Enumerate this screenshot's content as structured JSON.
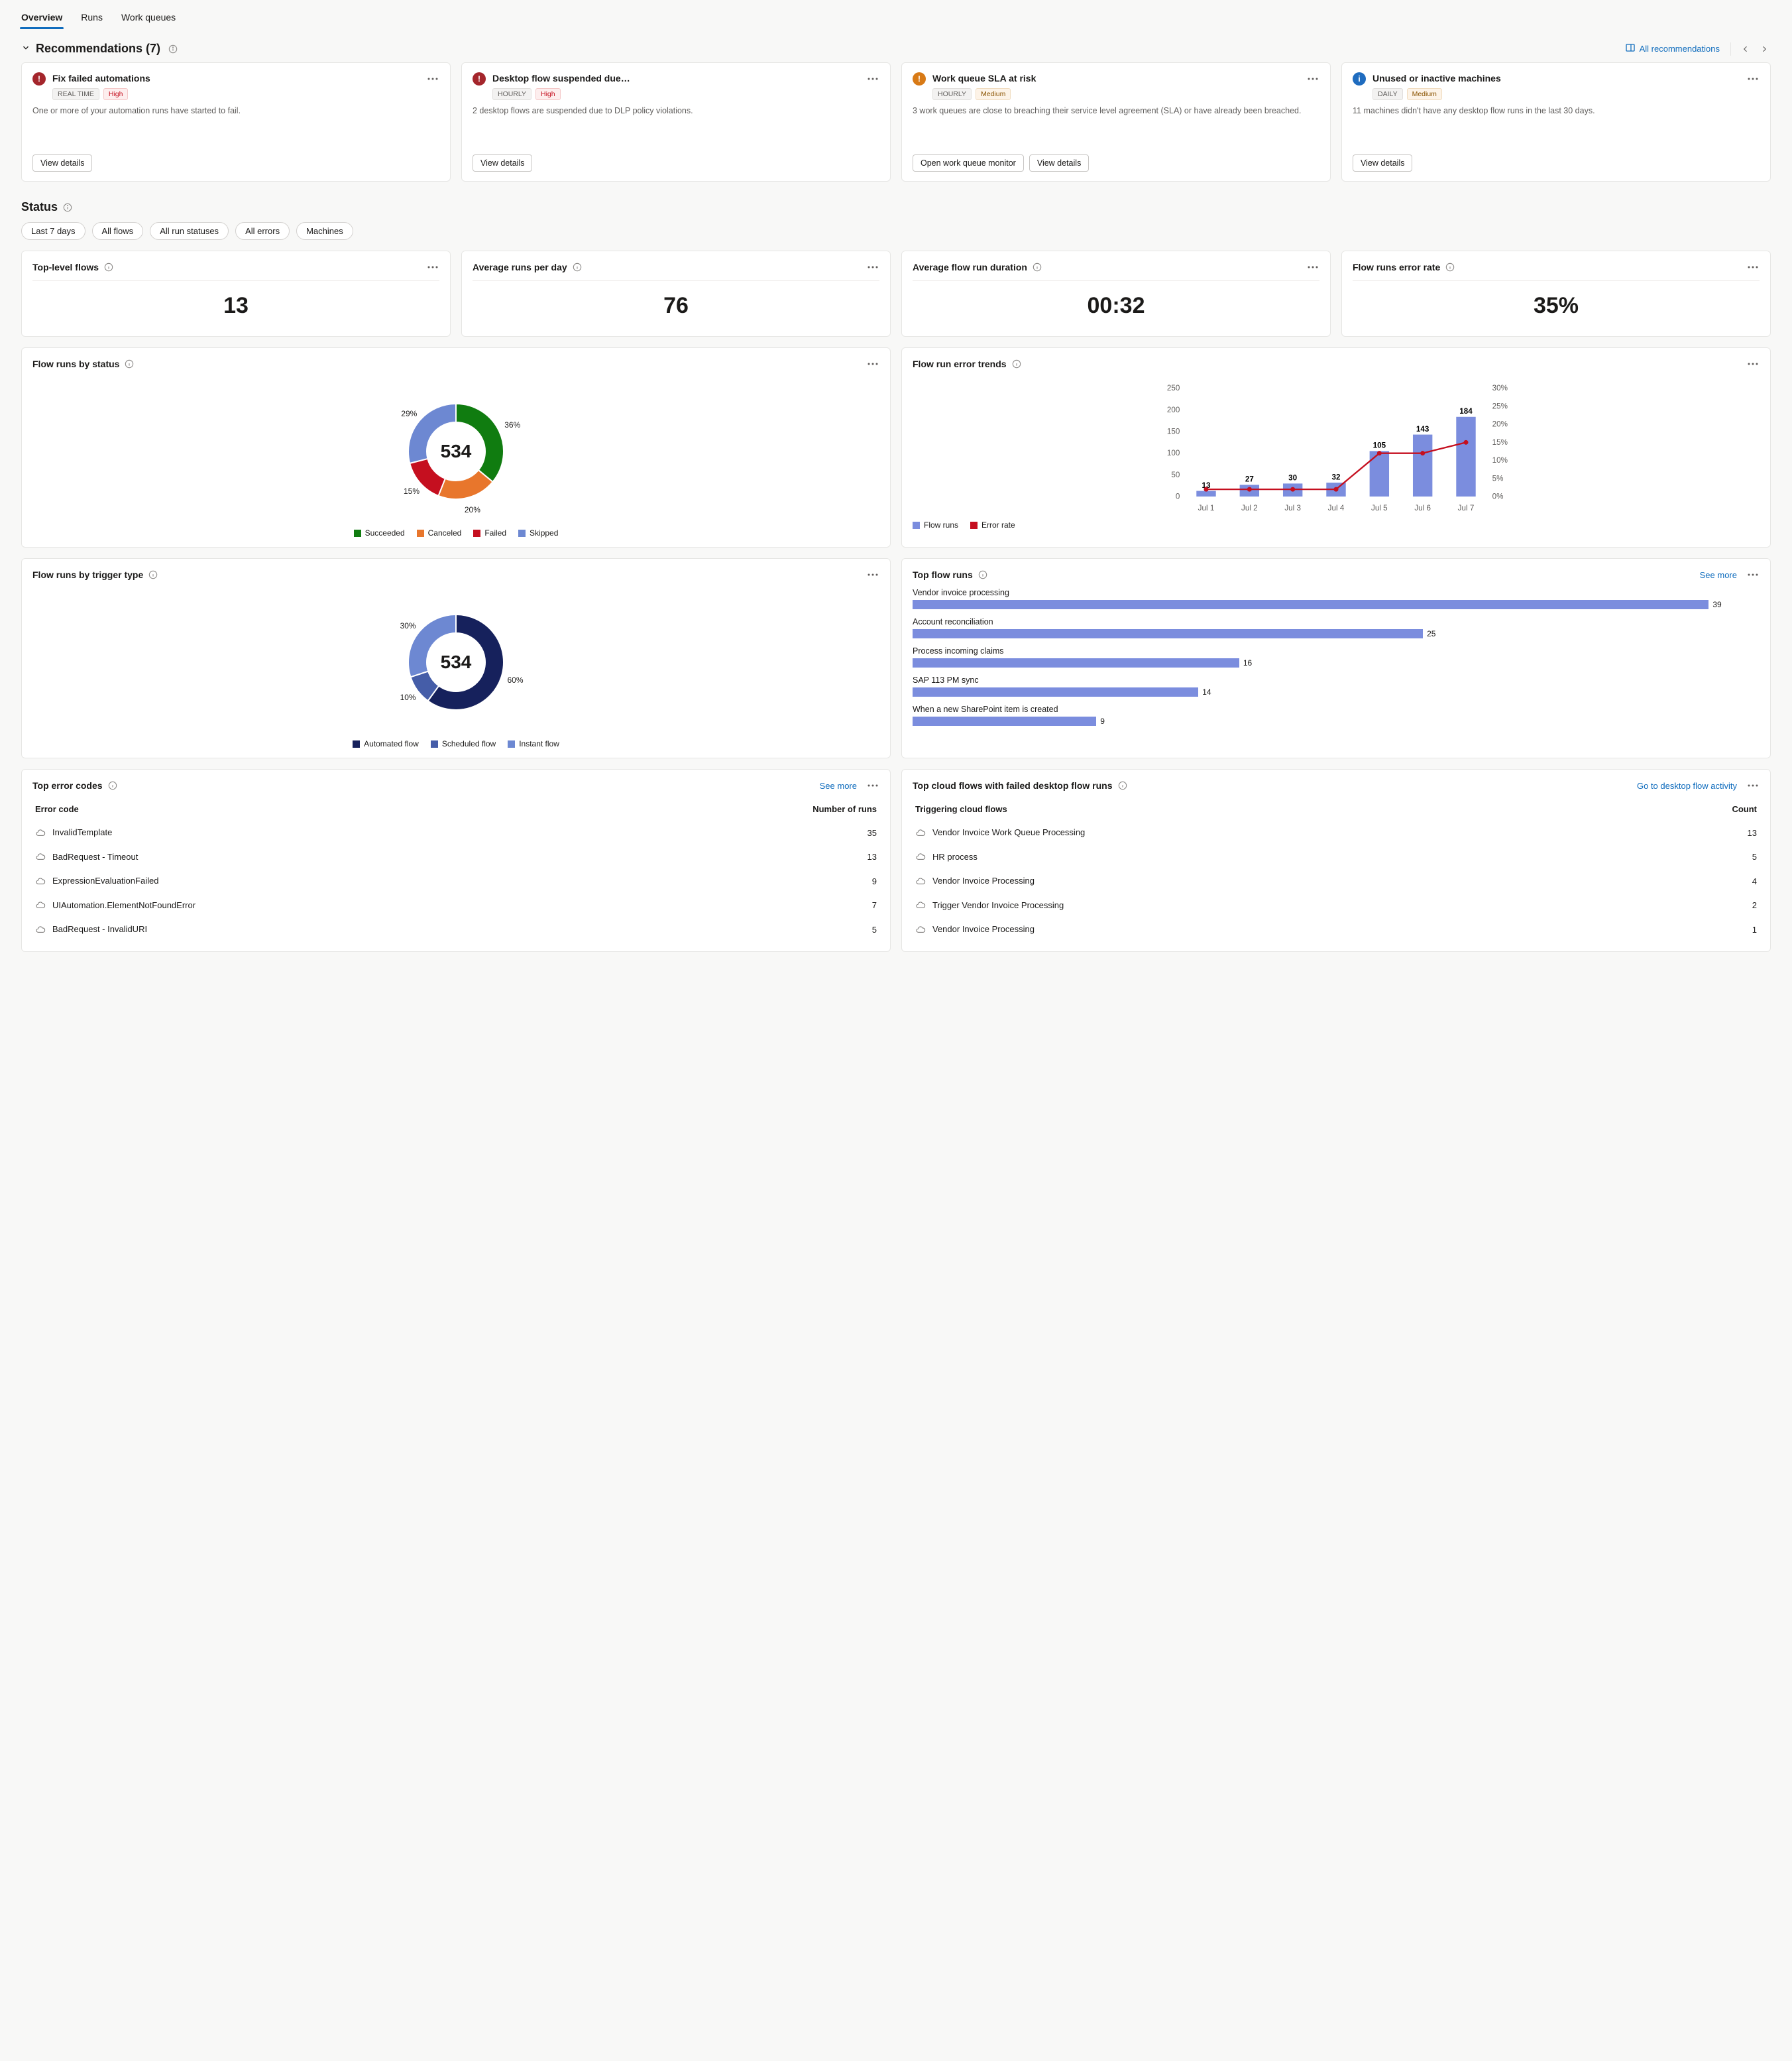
{
  "tabs": {
    "overview": "Overview",
    "runs": "Runs",
    "work_queues": "Work queues"
  },
  "recommendations": {
    "title": "Recommendations (7)",
    "all_link": "All recommendations",
    "cards": [
      {
        "title": "Fix failed automations",
        "freq": "REAL TIME",
        "sev": "High",
        "desc": "One or more of your automation runs have started to fail.",
        "btn1": "View details"
      },
      {
        "title": "Desktop flow suspended due…",
        "freq": "HOURLY",
        "sev": "High",
        "desc": "2 desktop flows are suspended due to DLP policy violations.",
        "btn1": "View details"
      },
      {
        "title": "Work queue SLA at risk",
        "freq": "HOURLY",
        "sev": "Medium",
        "desc": "3 work queues are close to breaching their service level agreement (SLA) or have already been breached.",
        "btn1": "Open work queue monitor",
        "btn2": "View details"
      },
      {
        "title": "Unused or inactive machines",
        "freq": "DAILY",
        "sev": "Medium",
        "desc": "11 machines didn't have any desktop flow runs in the last 30 days.",
        "btn1": "View details"
      }
    ]
  },
  "status": {
    "title": "Status",
    "filters": [
      "Last 7 days",
      "All flows",
      "All run statuses",
      "All errors",
      "Machines"
    ],
    "kpis": [
      {
        "title": "Top-level flows",
        "value": "13"
      },
      {
        "title": "Average runs per day",
        "value": "76"
      },
      {
        "title": "Average flow run duration",
        "value": "00:32"
      },
      {
        "title": "Flow runs error rate",
        "value": "35%"
      }
    ]
  },
  "charts": {
    "by_status": {
      "title": "Flow runs by status",
      "center": "534",
      "legend": [
        "Succeeded",
        "Canceled",
        "Failed",
        "Skipped"
      ]
    },
    "error_trends": {
      "title": "Flow run error trends",
      "legend": [
        "Flow runs",
        "Error rate"
      ]
    },
    "by_trigger": {
      "title": "Flow runs by trigger type",
      "center": "534",
      "legend": [
        "Automated flow",
        "Scheduled flow",
        "Instant flow"
      ]
    },
    "top_flow_runs": {
      "title": "Top flow runs",
      "link": "See more"
    },
    "top_errors": {
      "title": "Top error codes",
      "link": "See more",
      "col1": "Error code",
      "col2": "Number of runs"
    },
    "top_cloud": {
      "title": "Top cloud flows with failed desktop flow runs",
      "link": "Go to desktop flow activity",
      "col1": "Triggering cloud flows",
      "col2": "Count"
    }
  },
  "top_flow_runs_data": [
    {
      "label": "Vendor invoice processing",
      "value": 39
    },
    {
      "label": "Account reconciliation",
      "value": 25
    },
    {
      "label": "Process incoming claims",
      "value": 16
    },
    {
      "label": "SAP 113 PM sync",
      "value": 14
    },
    {
      "label": "When a new SharePoint item is created",
      "value": 9
    }
  ],
  "top_errors_data": [
    {
      "code": "InvalidTemplate",
      "runs": 35
    },
    {
      "code": "BadRequest - Timeout",
      "runs": 13
    },
    {
      "code": "ExpressionEvaluationFailed",
      "runs": 9
    },
    {
      "code": "UIAutomation.ElementNotFoundError",
      "runs": 7
    },
    {
      "code": "BadRequest - InvalidURI",
      "runs": 5
    }
  ],
  "top_cloud_data": [
    {
      "flow": "Vendor Invoice Work Queue Processing",
      "count": 13
    },
    {
      "flow": "HR process",
      "count": 5
    },
    {
      "flow": "Vendor Invoice Processing",
      "count": 4
    },
    {
      "flow": "Trigger Vendor Invoice Processing",
      "count": 2
    },
    {
      "flow": "Vendor Invoice Processing",
      "count": 1
    }
  ],
  "chart_data": [
    {
      "id": "flow_runs_by_status",
      "type": "pie",
      "title": "Flow runs by status",
      "total": 534,
      "series": [
        {
          "name": "Succeeded",
          "value": 36,
          "color": "#107c10"
        },
        {
          "name": "Canceled",
          "value": 20,
          "color": "#e8762c"
        },
        {
          "name": "Failed",
          "value": 15,
          "color": "#c50f1f"
        },
        {
          "name": "Skipped",
          "value": 29,
          "color": "#6d88d2"
        }
      ]
    },
    {
      "id": "flow_run_error_trends",
      "type": "bar+line",
      "title": "Flow run error trends",
      "categories": [
        "Jul 1",
        "Jul 2",
        "Jul 3",
        "Jul 4",
        "Jul 5",
        "Jul 6",
        "Jul 7"
      ],
      "series": [
        {
          "name": "Flow runs",
          "type": "bar",
          "values": [
            13,
            27,
            30,
            32,
            105,
            143,
            184
          ],
          "color": "#7b8dde",
          "axis": "left"
        },
        {
          "name": "Error rate",
          "type": "line",
          "values": [
            2,
            2,
            2,
            2,
            12,
            12,
            15
          ],
          "unit": "%",
          "color": "#c50f1f",
          "axis": "right"
        }
      ],
      "y_left": {
        "min": 0,
        "max": 250,
        "ticks": [
          0,
          50,
          100,
          150,
          200,
          250
        ]
      },
      "y_right": {
        "min": 0,
        "max": 30,
        "unit": "%",
        "ticks": [
          0,
          5,
          10,
          15,
          20,
          25,
          30
        ]
      }
    },
    {
      "id": "flow_runs_by_trigger",
      "type": "pie",
      "title": "Flow runs by trigger type",
      "total": 534,
      "series": [
        {
          "name": "Automated flow",
          "value": 60,
          "color": "#16215c"
        },
        {
          "name": "Scheduled flow",
          "value": 10,
          "color": "#455da8"
        },
        {
          "name": "Instant flow",
          "value": 30,
          "color": "#6d88d2"
        }
      ]
    },
    {
      "id": "top_flow_runs",
      "type": "bar",
      "orientation": "horizontal",
      "title": "Top flow runs",
      "categories": [
        "Vendor invoice processing",
        "Account reconciliation",
        "Process incoming claims",
        "SAP 113 PM sync",
        "When a new SharePoint item is created"
      ],
      "values": [
        39,
        25,
        16,
        14,
        9
      ]
    },
    {
      "id": "top_error_codes",
      "type": "table",
      "title": "Top error codes",
      "columns": [
        "Error code",
        "Number of runs"
      ],
      "rows": [
        [
          "InvalidTemplate",
          35
        ],
        [
          "BadRequest - Timeout",
          13
        ],
        [
          "ExpressionEvaluationFailed",
          9
        ],
        [
          "UIAutomation.ElementNotFoundError",
          7
        ],
        [
          "BadRequest - InvalidURI",
          5
        ]
      ]
    },
    {
      "id": "top_cloud_flows_failed",
      "type": "table",
      "title": "Top cloud flows with failed desktop flow runs",
      "columns": [
        "Triggering cloud flows",
        "Count"
      ],
      "rows": [
        [
          "Vendor Invoice Work Queue Processing",
          13
        ],
        [
          "HR process",
          5
        ],
        [
          "Vendor Invoice Processing",
          4
        ],
        [
          "Trigger Vendor Invoice Processing",
          2
        ],
        [
          "Vendor Invoice Processing",
          1
        ]
      ]
    }
  ]
}
